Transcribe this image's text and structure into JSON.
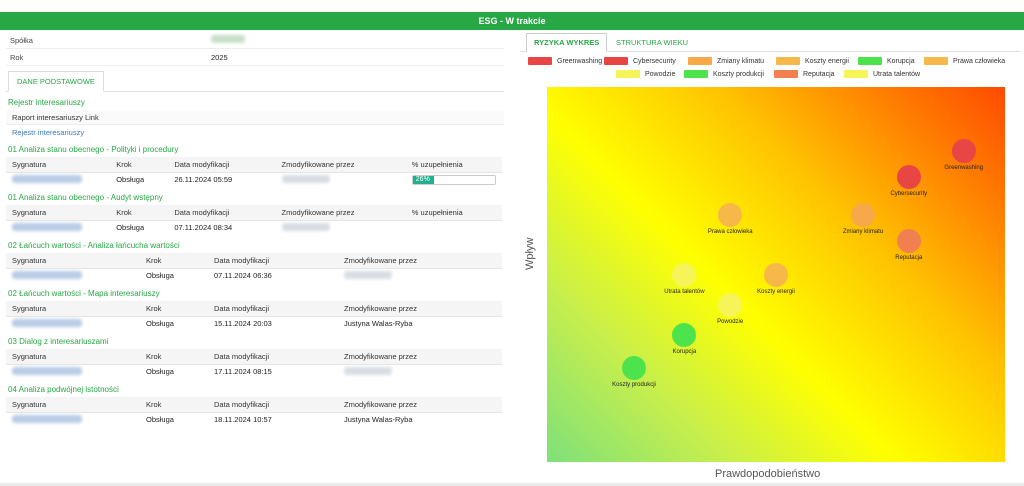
{
  "window": {
    "title": "ESG - W trakcie"
  },
  "company": {
    "label": "Spółka",
    "value": "Firma",
    "year_label": "Rok",
    "year_value": "2025"
  },
  "left_tab": "DANE PODSTAWOWE",
  "register": {
    "title": "Rejestr interesariuszy",
    "sub_label": "Raport interesariuszy Link",
    "link": "Rejestr interesariuszy"
  },
  "sections": [
    {
      "title": "01 Analiza stanu obecnego - Polityki i procedury",
      "headers": [
        "Sygnatura",
        "Krok",
        "Data modyfikacji",
        "Zmodyfikowane przez",
        "% uzupełnienia"
      ],
      "row": {
        "signature": "ESG/0001/2024",
        "step": "Obsługa",
        "date": "26.11.2024 05:59",
        "by": "Daniel Kowalski",
        "progress": "26%"
      },
      "progress_value": 26
    },
    {
      "title": "01 Analiza stanu obecnego - Audyt wstępny",
      "headers": [
        "Sygnatura",
        "Krok",
        "Data modyfikacji",
        "Zmodyfikowane przez",
        "% uzupełnienia"
      ],
      "row": {
        "signature": "ESG/0002/2024",
        "step": "Obsługa",
        "date": "07.11.2024 08:34",
        "by": "Daniel Kowalski",
        "progress": ""
      }
    },
    {
      "title": "02 Łańcuch wartości - Analiza łańcucha wartości",
      "headers": [
        "Sygnatura",
        "Krok",
        "Data modyfikacji",
        "Zmodyfikowane przez"
      ],
      "row": {
        "signature": "ESG/0003/2024",
        "step": "Obsługa",
        "date": "07.11.2024 06:36",
        "by": "Daniel Kowalski"
      }
    },
    {
      "title": "02 Łańcuch wartości - Mapa interesariuszy",
      "headers": [
        "Sygnatura",
        "Krok",
        "Data modyfikacji",
        "Zmodyfikowane przez"
      ],
      "row": {
        "signature": "ESG/0004/2024",
        "step": "Obsługa",
        "date": "15.11.2024 20:03",
        "by": "Justyna Walas-Ryba"
      }
    },
    {
      "title": "03 Dialog z interesariuszami",
      "headers": [
        "Sygnatura",
        "Krok",
        "Data modyfikacji",
        "Zmodyfikowane przez"
      ],
      "row": {
        "signature": "ESG/0005/2024",
        "step": "Obsługa",
        "date": "17.11.2024 08:15",
        "by": "Daniel Kowalski"
      }
    },
    {
      "title": "04 Analiza podwójnej istotności",
      "headers": [
        "Sygnatura",
        "Krok",
        "Data modyfikacji",
        "Zmodyfikowane przez"
      ],
      "row": {
        "signature": "ESG/0006/2024",
        "step": "Obsługa",
        "date": "18.11.2024 10:57",
        "by": "Justyna Walas-Ryba"
      }
    }
  ],
  "right_tabs": {
    "active": "RYZYKA WYKRES",
    "other": "STRUKTURA WIEKU"
  },
  "chart_data": {
    "type": "scatter",
    "xlabel": "Prawdopodobieństwo",
    "ylabel": "Wpływ",
    "xlim": [
      0,
      10
    ],
    "ylim": [
      0,
      10
    ],
    "legend_placement": "top",
    "series": [
      {
        "name": "Greenwashing",
        "color": "#e84545",
        "x": 9.1,
        "y": 8.3
      },
      {
        "name": "Cybersecurity",
        "color": "#e84545",
        "x": 7.9,
        "y": 7.6
      },
      {
        "name": "Zmiany klimatu",
        "color": "#f7a94a",
        "x": 6.9,
        "y": 6.6
      },
      {
        "name": "Koszty energii",
        "color": "#f7b84a",
        "x": 5.0,
        "y": 5.0
      },
      {
        "name": "Korupcja",
        "color": "#4de34d",
        "x": 3.0,
        "y": 3.4
      },
      {
        "name": "Prawa człowieka",
        "color": "#f7b84a",
        "x": 4.0,
        "y": 6.6
      },
      {
        "name": "Powodzie",
        "color": "#f5f55a",
        "x": 4.0,
        "y": 4.2
      },
      {
        "name": "Koszty produkcji",
        "color": "#4de34d",
        "x": 1.9,
        "y": 2.5
      },
      {
        "name": "Reputacja",
        "color": "#f08050",
        "x": 7.9,
        "y": 5.9
      },
      {
        "name": "Utrata talentów",
        "color": "#f5f55a",
        "x": 3.0,
        "y": 5.0
      }
    ]
  }
}
